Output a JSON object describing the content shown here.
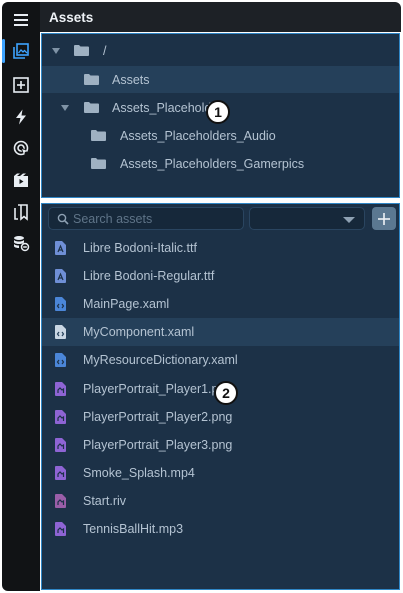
{
  "header": {
    "title": "Assets"
  },
  "rail": {
    "items": [
      {
        "icon": "menu-icon"
      },
      {
        "icon": "assets-icon"
      },
      {
        "icon": "add-box-icon"
      },
      {
        "icon": "lightning-icon"
      },
      {
        "icon": "target-icon"
      },
      {
        "icon": "video-icon"
      },
      {
        "icon": "pages-icon"
      },
      {
        "icon": "database-icon"
      }
    ]
  },
  "tree": {
    "items": [
      {
        "label": "/",
        "expanded": true
      },
      {
        "label": "Assets",
        "selected": true
      },
      {
        "label": "Assets_Placeholders",
        "expanded": true
      },
      {
        "label": "Assets_Placeholders_Audio"
      },
      {
        "label": "Assets_Placeholders_Gamerpics"
      }
    ]
  },
  "list": {
    "search_placeholder": "Search assets",
    "add_label": "+",
    "files": [
      {
        "name": "Libre Bodoni-Italic.ttf",
        "type": "font",
        "color": "#6f8fd6"
      },
      {
        "name": "Libre Bodoni-Regular.ttf",
        "type": "font",
        "color": "#6f8fd6"
      },
      {
        "name": "MainPage.xaml",
        "type": "xaml",
        "color": "#4b86d8"
      },
      {
        "name": "MyComponent.xaml",
        "type": "xaml",
        "color": "#4b86d8",
        "selected": true
      },
      {
        "name": "MyResourceDictionary.xaml",
        "type": "xaml",
        "color": "#4b86d8"
      },
      {
        "name": "PlayerPortrait_Player1.png",
        "type": "image",
        "color": "#8e64d4"
      },
      {
        "name": "PlayerPortrait_Player2.png",
        "type": "image",
        "color": "#8e64d4"
      },
      {
        "name": "PlayerPortrait_Player3.png",
        "type": "image",
        "color": "#8e64d4"
      },
      {
        "name": "Smoke_Splash.mp4",
        "type": "video",
        "color": "#8e64d4"
      },
      {
        "name": "Start.riv",
        "type": "riv",
        "color": "#9a5ea8"
      },
      {
        "name": "TennisBallHit.mp3",
        "type": "audio",
        "color": "#8e64d4"
      }
    ]
  },
  "callouts": [
    "1",
    "2"
  ],
  "colors": {
    "accent": "#3ea4ff",
    "panel": "#1c3147",
    "selected": "#25405a",
    "border": "#2f86c6"
  }
}
